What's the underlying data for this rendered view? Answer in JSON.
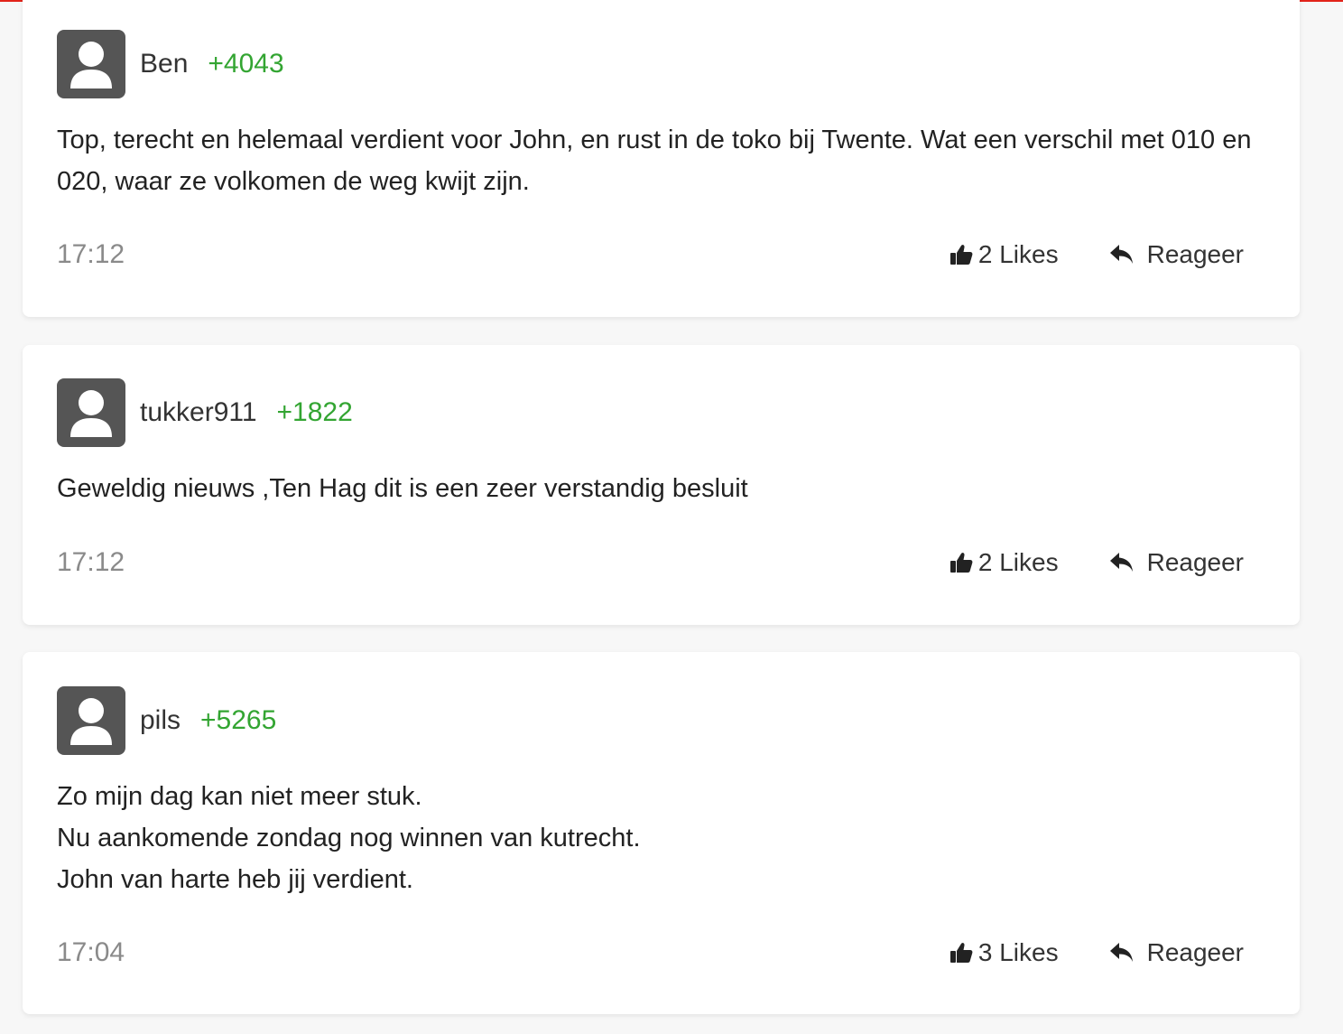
{
  "colors": {
    "accent_red": "#e2231a",
    "points_green": "#33a532",
    "timestamp_gray": "#8a8a8a",
    "avatar_bg": "#555555"
  },
  "icons": {
    "avatar": "user-silhouette-icon",
    "like": "thumbs-up-icon",
    "reply": "reply-arrow-icon"
  },
  "comments": [
    {
      "username": "Ben",
      "points": "+4043",
      "text": "Top, terecht en helemaal verdient voor John, en rust in de toko bij Twente. Wat een verschil met 010 en 020, waar ze volkomen de weg kwijt zijn.",
      "time": "17:12",
      "likes_label": "2 Likes",
      "reply_label": "Reageer"
    },
    {
      "username": "tukker911",
      "points": "+1822",
      "text": "Geweldig nieuws ,Ten Hag dit is een zeer verstandig besluit",
      "time": "17:12",
      "likes_label": "2 Likes",
      "reply_label": "Reageer"
    },
    {
      "username": "pils",
      "points": "+5265",
      "text": "Zo mijn dag kan niet meer stuk.\nNu aankomende zondag nog winnen van kutrecht.\nJohn van harte heb jij verdient.",
      "time": "17:04",
      "likes_label": "3 Likes",
      "reply_label": "Reageer"
    }
  ]
}
